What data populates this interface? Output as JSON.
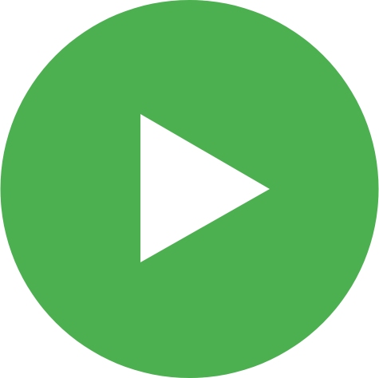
{
  "play_button": {
    "icon": "play-icon",
    "circle_color": "#4caf50",
    "triangle_color": "#ffffff"
  }
}
